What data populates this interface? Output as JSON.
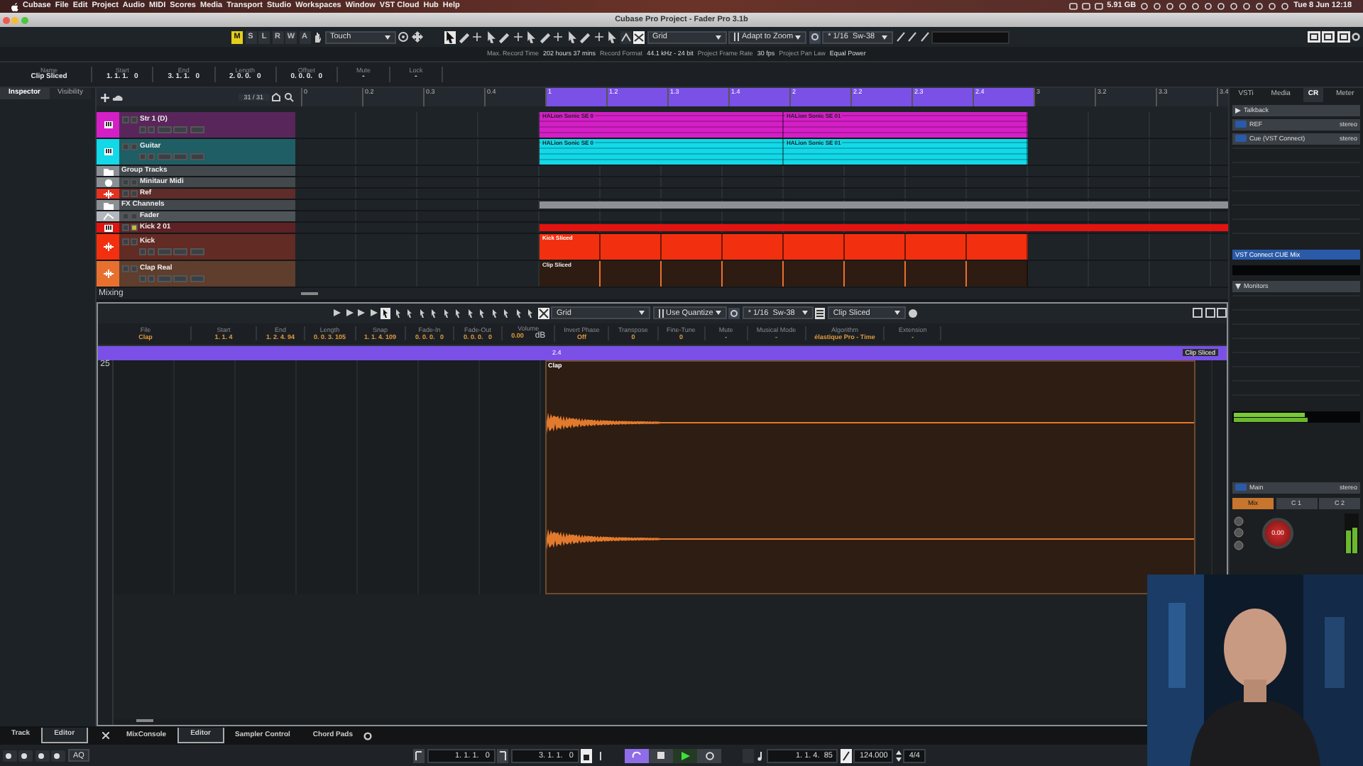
{
  "menu_bar": {
    "items": [
      "Cubase",
      "File",
      "Edit",
      "Project",
      "Audio",
      "MIDI",
      "Scores",
      "Media",
      "Transport",
      "Studio",
      "Workspaces",
      "Window",
      "VST Cloud",
      "Hub",
      "Help"
    ],
    "memory": "5.91 GB",
    "clock": "Tue 8 Jun  12:18"
  },
  "window": {
    "title": "Cubase Pro Project - Fader Pro 3.1b"
  },
  "toolbar": {
    "automation_buttons": [
      {
        "label": "M",
        "on": true
      },
      {
        "label": "S",
        "on": false
      },
      {
        "label": "L",
        "on": false
      },
      {
        "label": "R",
        "on": false
      },
      {
        "label": "W",
        "on": false
      },
      {
        "label": "A",
        "on": false
      }
    ],
    "automation_mode": "Touch",
    "snap_type": "Grid",
    "grid_type": "Adapt to Zoom",
    "quantize": "* 1/16  Sw-38"
  },
  "status_line": [
    {
      "label": "Max. Record Time",
      "value": "202 hours 37 mins"
    },
    {
      "label": "Record Format",
      "value": "44.1 kHz - 24 bit"
    },
    {
      "label": "Project Frame Rate",
      "value": "30 fps"
    },
    {
      "label": "Project Pan Law",
      "value": "Equal Power"
    }
  ],
  "info_line": [
    {
      "label": "Name",
      "value": "Clip Sliced"
    },
    {
      "label": "Start",
      "value": "1. 1. 1.   0"
    },
    {
      "label": "End",
      "value": "3. 1. 1.   0"
    },
    {
      "label": "Length",
      "value": "2. 0. 0.   0"
    },
    {
      "label": "Offset",
      "value": "0. 0. 0.   0"
    },
    {
      "label": "Mute",
      "value": "-"
    },
    {
      "label": "Lock",
      "value": "-"
    }
  ],
  "left_zone": {
    "tabs": [
      {
        "label": "Inspector",
        "selected": true
      },
      {
        "label": "Visibility",
        "selected": false
      }
    ],
    "bottom_tabs": [
      {
        "label": "Track",
        "selected": false
      },
      {
        "label": "Editor",
        "selected": true
      }
    ]
  },
  "track_list": {
    "counter": "31 / 31",
    "footer": "Mixing",
    "tracks": [
      {
        "name": "Str 1 (D)",
        "kind": "instrument",
        "expanded": true,
        "color": "#d41fc6",
        "lane": {
          "kind": "regions",
          "regions": [
            {
              "label": "HALion Sonic SE 0",
              "selected": false
            },
            {
              "label": "HALion Sonic SE 01",
              "selected": false
            }
          ]
        }
      },
      {
        "name": "Guitar",
        "kind": "instrument",
        "expanded": true,
        "color": "#12d8e8",
        "lane": {
          "kind": "regions",
          "regions": [
            {
              "label": "HALion Sonic SE 0",
              "selected": false
            },
            {
              "label": "HALion Sonic SE 01",
              "selected": false
            }
          ]
        }
      },
      {
        "name": "Group Tracks",
        "kind": "folder",
        "expanded": false,
        "color": "#8a8f94"
      },
      {
        "name": "Minitaur Midi",
        "kind": "midi",
        "expanded": false,
        "color": "#8a8f94"
      },
      {
        "name": "Ref",
        "kind": "audio",
        "expanded": false,
        "color": "#e5321f"
      },
      {
        "name": "FX Channels",
        "kind": "folder",
        "expanded": false,
        "color": "#8a8f94",
        "lane": {
          "kind": "bar"
        }
      },
      {
        "name": "Fader",
        "kind": "automation",
        "expanded": false,
        "color": "#b4b8bc"
      },
      {
        "name": "Kick 2 01",
        "kind": "instrument",
        "expanded": false,
        "color": "#e3130f",
        "lane": {
          "kind": "bar"
        }
      },
      {
        "name": "Kick",
        "kind": "audio",
        "expanded": true,
        "color": "#f2300f",
        "lane": {
          "kind": "sliced",
          "regions": [
            {
              "label": "Kick Sliced",
              "selected": false
            }
          ]
        }
      },
      {
        "name": "Clap Real",
        "kind": "audio",
        "expanded": true,
        "color": "#e8702e",
        "lane": {
          "kind": "sliced",
          "regions": [
            {
              "label": "Clip Sliced",
              "selected": true
            }
          ]
        }
      }
    ]
  },
  "ruler": [
    {
      "label": "0",
      "in_range": false
    },
    {
      "label": "0.2",
      "in_range": false
    },
    {
      "label": "0.3",
      "in_range": false
    },
    {
      "label": "0.4",
      "in_range": false
    },
    {
      "label": "1",
      "in_range": true
    },
    {
      "label": "1.2",
      "in_range": true
    },
    {
      "label": "1.3",
      "in_range": true
    },
    {
      "label": "1.4",
      "in_range": true
    },
    {
      "label": "2",
      "in_range": true
    },
    {
      "label": "2.2",
      "in_range": true
    },
    {
      "label": "2.3",
      "in_range": true
    },
    {
      "label": "2.4",
      "in_range": true
    },
    {
      "label": "3",
      "in_range": false
    },
    {
      "label": "3.2",
      "in_range": false
    },
    {
      "label": "3.3",
      "in_range": false
    },
    {
      "label": "3.4",
      "in_range": false
    }
  ],
  "right_zone": {
    "tabs": [
      {
        "label": "VSTi",
        "selected": false
      },
      {
        "label": "Media",
        "selected": false
      },
      {
        "label": "CR",
        "selected": true
      },
      {
        "label": "Meter",
        "selected": false
      }
    ],
    "talkback": "Talkback",
    "channels": [
      {
        "name": "REF",
        "format": "stereo"
      },
      {
        "name": "Cue (VST Connect)",
        "format": "stereo"
      }
    ],
    "cue_mix": "VST Connect CUE Mix",
    "monitors": "Monitors",
    "main": {
      "name": "Main",
      "format": "stereo"
    },
    "sources": [
      {
        "label": "Mix",
        "selected": true
      },
      {
        "label": "C 1",
        "selected": false
      },
      {
        "label": "C 2",
        "selected": false
      }
    ],
    "knob": "0.00"
  },
  "editor": {
    "toolbar": {
      "snap_type": "Grid",
      "quantize_mode": "Use Quantize",
      "quantize": "* 1/16  Sw-38",
      "event": "Clip Sliced"
    },
    "info_line": [
      {
        "label": "File",
        "value": "Clap"
      },
      {
        "label": "Start",
        "value": "1. 1. 4"
      },
      {
        "label": "End",
        "value": "1. 2. 4. 94"
      },
      {
        "label": "Length",
        "value": "0. 0. 3. 105"
      },
      {
        "label": "Snap",
        "value": "1. 1. 4. 109"
      },
      {
        "label": "Fade-In",
        "value": "0. 0. 0.   0"
      },
      {
        "label": "Fade-Out",
        "value": "0. 0. 0.   0"
      },
      {
        "label": "Volume",
        "value": "0.00"
      },
      {
        "label": "Invert Phase",
        "value": "Off"
      },
      {
        "label": "Transpose",
        "value": "0"
      },
      {
        "label": "Fine-Tune",
        "value": "0"
      },
      {
        "label": "Mute",
        "value": "-"
      },
      {
        "label": "Musical Mode",
        "value": "-"
      },
      {
        "label": "Algorithm",
        "value": "élastique Pro - Time"
      },
      {
        "label": "Extension",
        "value": "-"
      }
    ],
    "volume_unit": "dB",
    "ruler": "2.4",
    "region_label": "Clip Sliced",
    "event": "Clap",
    "lane_number": "25"
  },
  "lower_zone": {
    "tabs": [
      {
        "label": "MixConsole",
        "selected": false
      },
      {
        "label": "Editor",
        "selected": true
      },
      {
        "label": "Sampler Control",
        "selected": false
      },
      {
        "label": "Chord Pads",
        "selected": false
      }
    ]
  },
  "transport": {
    "aq": "AQ",
    "left_locator": "1. 1. 1.   0",
    "right_locator": "3. 1. 1.   0",
    "cycle": true,
    "playing": true,
    "position": "1. 1. 4.  85",
    "tempo": "124.000",
    "signature": "4/4"
  }
}
